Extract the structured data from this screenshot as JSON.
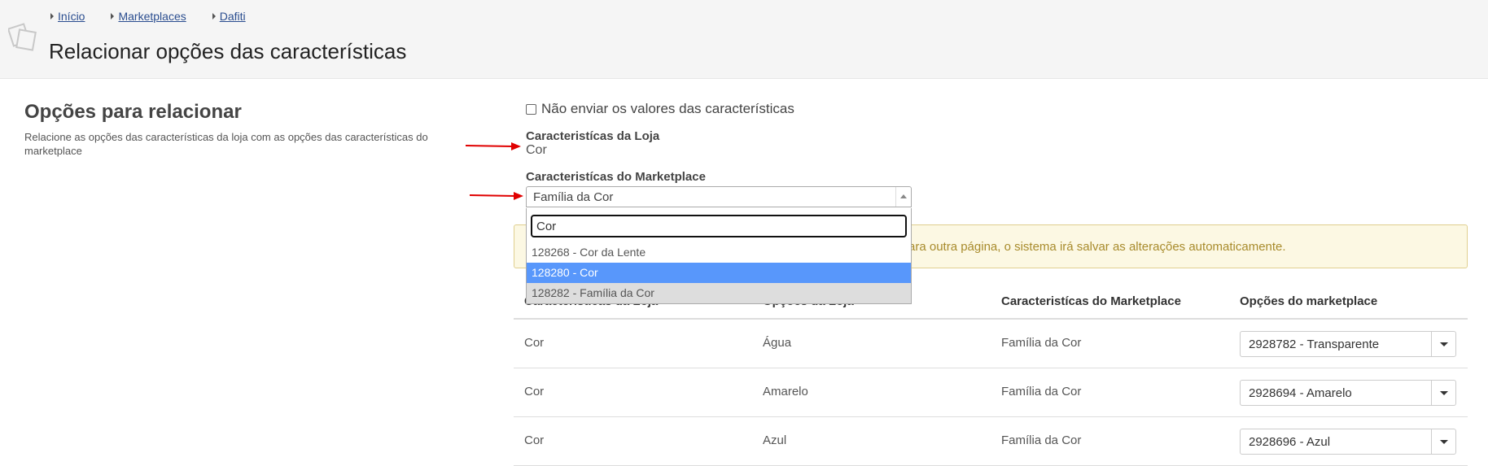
{
  "breadcrumb": [
    "Início",
    "Marketplaces",
    "Dafiti"
  ],
  "page_title": "Relacionar opções das características",
  "left": {
    "title": "Opções para relacionar",
    "description": "Relacione as opções das características da loja com as opções das características do marketplace"
  },
  "form": {
    "no_send_label": "Não enviar os valores das características",
    "store_label": "Caracteristícas da Loja",
    "store_value": "Cor",
    "marketplace_label": "Caracteristícas do Marketplace",
    "marketplace_value": "Família da Cor"
  },
  "dropdown": {
    "search_value": "Cor",
    "options": [
      "128268 - Cor da Lente",
      "128280 - Cor",
      "128282 - Família da Cor"
    ],
    "highlighted": "128280 - Cor"
  },
  "alert": {
    "message": "ara outra página, o sistema irá salvar as alterações automaticamente."
  },
  "table": {
    "headers": [
      "Caracteristícas da Loja",
      "Opções da Loja",
      "Caracteristícas do Marketplace",
      "Opções do marketplace"
    ],
    "rows": [
      {
        "store_char": "Cor",
        "store_opt": "Água",
        "mp_char": "Família da Cor",
        "mp_opt": "2928782 - Transparente"
      },
      {
        "store_char": "Cor",
        "store_opt": "Amarelo",
        "mp_char": "Família da Cor",
        "mp_opt": "2928694 - Amarelo"
      },
      {
        "store_char": "Cor",
        "store_opt": "Azul",
        "mp_char": "Família da Cor",
        "mp_opt": "2928696 - Azul"
      }
    ]
  },
  "colors": {
    "arrow": "#e00000",
    "highlight": "#5897fb",
    "alert_bg": "#fcf8e3",
    "alert_text": "#a88b2c",
    "link": "#2a4d8f"
  }
}
